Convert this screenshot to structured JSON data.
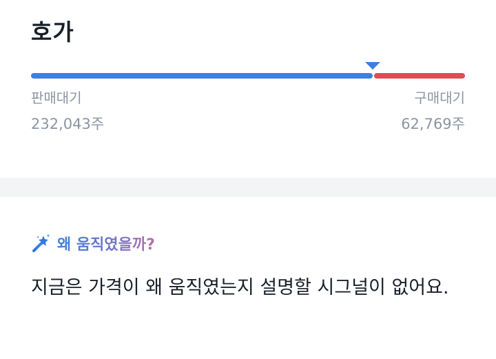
{
  "orderbook": {
    "title": "호가",
    "sell_label": "판매대기",
    "sell_value": "232,043주",
    "buy_label": "구매대기",
    "buy_value": "62,769주",
    "sell_ratio": 0.787,
    "sell_color": "#3d7fe0",
    "buy_color": "#e24a55"
  },
  "why": {
    "icon": "magic-wand-icon",
    "title": "왜 움직였을까?",
    "body": "지금은 가격이 왜 움직였는지 설명할 시그널이 없어요."
  }
}
